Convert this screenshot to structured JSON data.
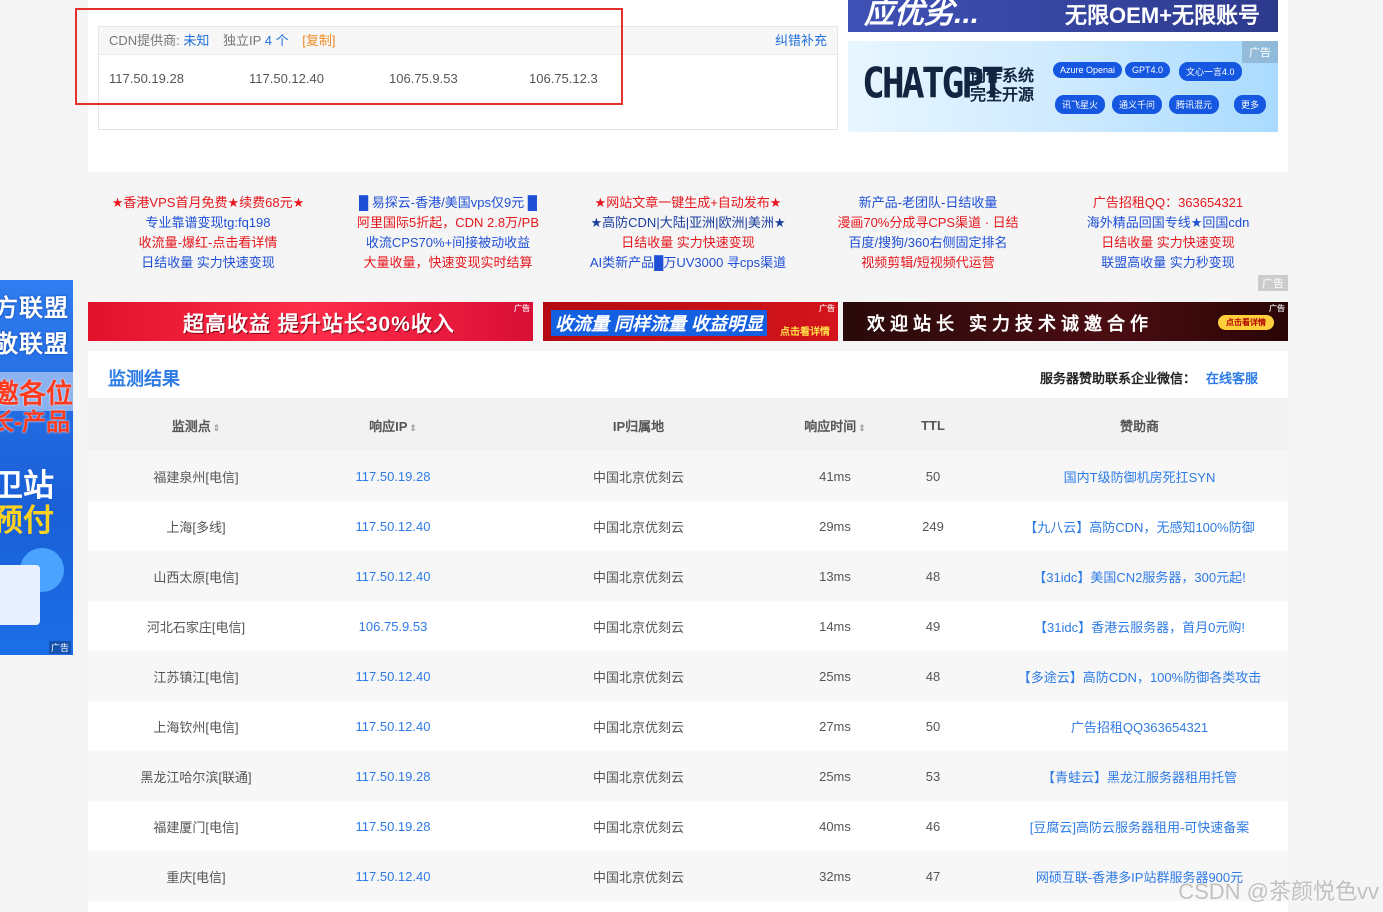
{
  "left_ad": {
    "line1": "方联盟",
    "line2": "敬联盟",
    "line3": "邀各位",
    "line4": "长-产品",
    "line5": "卫站",
    "line6": "预付",
    "tag": "广告"
  },
  "cdn": {
    "provider_label": "CDN提供商:",
    "provider_value": "未知",
    "ip_label": "独立IP",
    "ip_count": "4 个",
    "copy": "[复制]",
    "report": "纠错补充",
    "ips": [
      "117.50.19.28",
      "117.50.12.40",
      "106.75.9.53",
      "106.75.12.3"
    ]
  },
  "top_ads": {
    "banner_left": "应优劣...",
    "banner_right": "无限OEM+无限账号",
    "chatgpt_big": "CHATGPT",
    "chatgpt_sub1": "创作系统",
    "chatgpt_sub2": "完全开源",
    "pills": [
      "Azure Openai",
      "GPT4.0",
      "文心一言4.0",
      "讯飞星火",
      "通义千问",
      "腾讯混元",
      "更多"
    ],
    "tag": "广告"
  },
  "text_ads": [
    {
      "lines": [
        "★香港VPS首月免费★续费68元★",
        "专业靠谱变现tg:fq198",
        "收流量-爆红-点击看详情",
        "日结收量 实力快速变现"
      ],
      "colors": [
        "#e6161c",
        "#1e4fd6",
        "#e6161c",
        "#1e4fd6"
      ]
    },
    {
      "lines": [
        "█ 易探云-香港/美国vps仅9元 █",
        "阿里国际5折起，CDN 2.8万/PB",
        "收流CPS70%+间接被动收益",
        "大量收量，快速变现实时结算"
      ],
      "colors": [
        "#1e4fd6",
        "#e6161c",
        "#1e4fd6",
        "#e6161c"
      ]
    },
    {
      "lines": [
        "★网站文章一键生成+自动发布★",
        "★高防CDN|大陆|亚洲|欧洲|美洲★",
        "日结收量 实力快速变现",
        "AI类新产品█万UV3000 寻cps渠道"
      ],
      "colors": [
        "#e6161c",
        "#1a3e9e",
        "#e6161c",
        "#1e4fd6"
      ]
    },
    {
      "lines": [
        "新产品-老团队-日结收量",
        "漫画70%分成寻CPS渠道 · 日结",
        "百度/搜狗/360右侧固定排名",
        "视频剪辑/短视频代运营"
      ],
      "colors": [
        "#1e4fd6",
        "#e6161c",
        "#1e4fd6",
        "#e6161c"
      ]
    },
    {
      "lines": [
        "广告招租QQ：363654321",
        "海外精品回国专线★回国cdn",
        "日结收量 实力快速变现",
        "联盟高收量 实力秒变现"
      ],
      "colors": [
        "#e6161c",
        "#1e4fd6",
        "#e6161c",
        "#1e4fd6"
      ]
    }
  ],
  "text_ads_tag": "广告",
  "banners": {
    "b1": "超高收益 提升站长30%收入",
    "b2": "收流量 同样流量 收益明显",
    "b2_small": "点击看详情",
    "b3": "欢迎站长 实力技术诚邀合作",
    "b3_btn": "点击看详情",
    "tag": "广告"
  },
  "result": {
    "title": "监测结果",
    "sponsor_label": "服务器赞助联系企业微信：",
    "sponsor_link": "在线客服",
    "headers": [
      "监测点",
      "响应IP",
      "IP归属地",
      "响应时间",
      "TTL",
      "赞助商"
    ],
    "sort_icon": "⇕",
    "rows": [
      [
        "福建泉州[电信]",
        "117.50.19.28",
        "中国北京优刻云",
        "41ms",
        "50",
        "国内T级防御机房死扛SYN"
      ],
      [
        "上海[多线]",
        "117.50.12.40",
        "中国北京优刻云",
        "29ms",
        "249",
        "【九八云】高防CDN，无感知100%防御"
      ],
      [
        "山西太原[电信]",
        "117.50.12.40",
        "中国北京优刻云",
        "13ms",
        "48",
        "【31idc】美国CN2服务器，300元起!"
      ],
      [
        "河北石家庄[电信]",
        "106.75.9.53",
        "中国北京优刻云",
        "14ms",
        "49",
        "【31idc】香港云服务器，首月0元购!"
      ],
      [
        "江苏镇江[电信]",
        "117.50.12.40",
        "中国北京优刻云",
        "25ms",
        "48",
        "【多途云】高防CDN，100%防御各类攻击"
      ],
      [
        "上海钦州[电信]",
        "117.50.12.40",
        "中国北京优刻云",
        "27ms",
        "50",
        "广告招租QQ363654321"
      ],
      [
        "黑龙江哈尔滨[联通]",
        "117.50.19.28",
        "中国北京优刻云",
        "25ms",
        "53",
        "【青蛙云】黑龙江服务器租用托管"
      ],
      [
        "福建厦门[电信]",
        "117.50.19.28",
        "中国北京优刻云",
        "40ms",
        "46",
        "[豆腐云]高防云服务器租用-可快速备案"
      ],
      [
        "重庆[电信]",
        "117.50.12.40",
        "中国北京优刻云",
        "32ms",
        "47",
        "网硕互联-香港多IP站群服务器900元"
      ]
    ]
  },
  "watermark": "CSDN @茶颜悦色vv"
}
